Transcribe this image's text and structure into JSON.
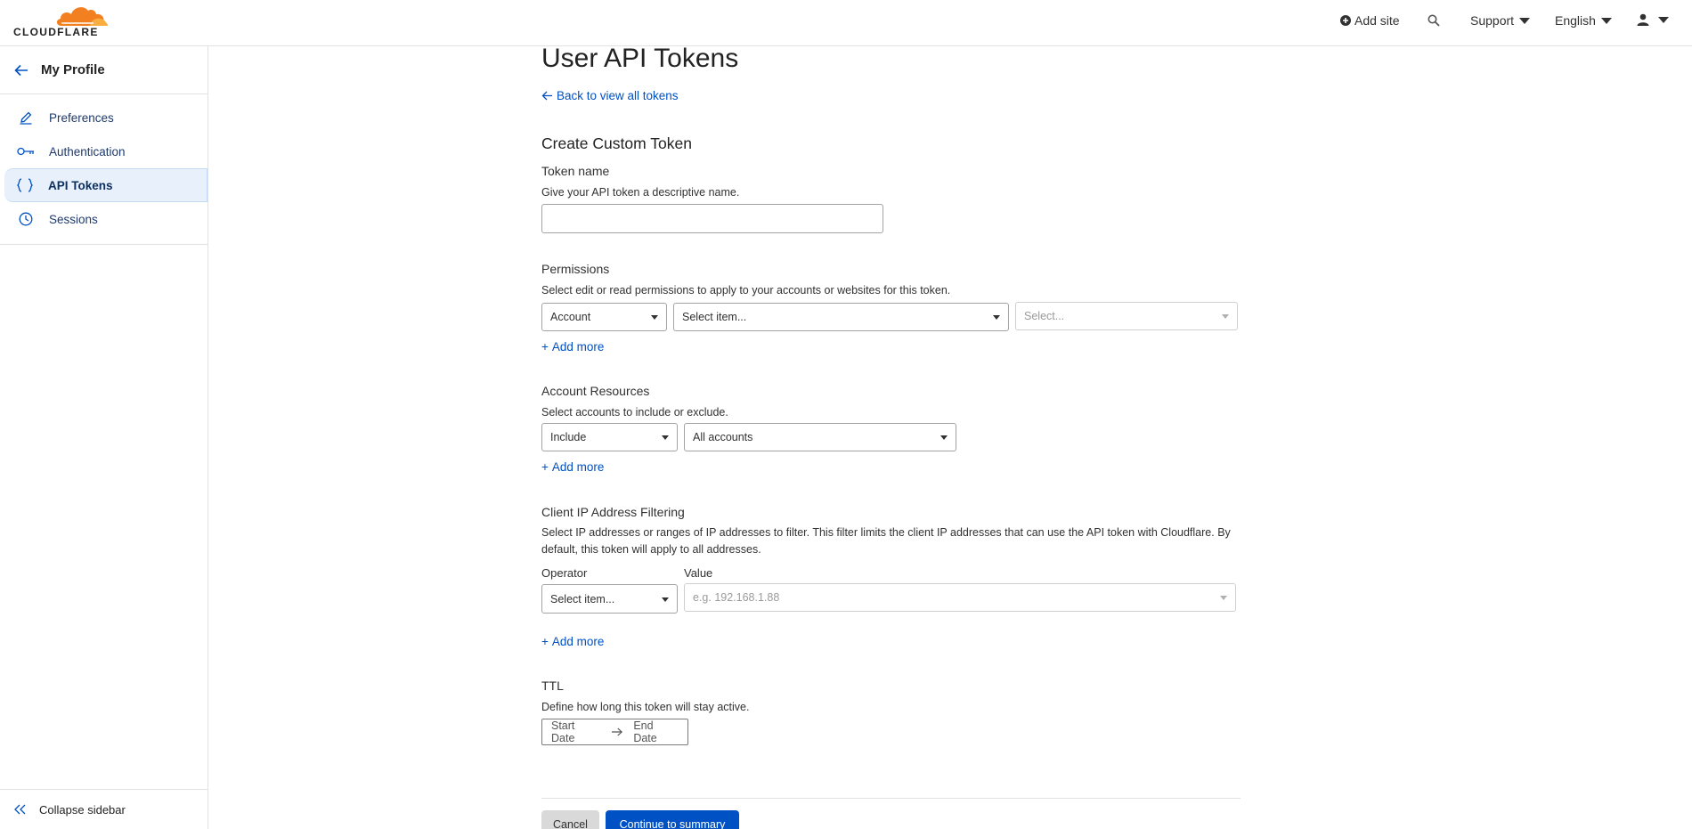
{
  "brand": {
    "name": "CLOUDFLARE",
    "accent": "#f38020",
    "link": "#0051c3"
  },
  "topnav": {
    "add_site": "Add site",
    "support": "Support",
    "language": "English"
  },
  "sidebar": {
    "title": "My Profile",
    "items": [
      {
        "label": "Preferences",
        "icon": "pencil-icon"
      },
      {
        "label": "Authentication",
        "icon": "key-icon"
      },
      {
        "label": "API Tokens",
        "icon": "braces-icon",
        "active": true
      },
      {
        "label": "Sessions",
        "icon": "clock-icon"
      }
    ],
    "collapse": "Collapse sidebar"
  },
  "main": {
    "title": "User API Tokens",
    "back_link": "Back to view all tokens",
    "section_title": "Create Custom Token",
    "token_name": {
      "label": "Token name",
      "help": "Give your API token a descriptive name.",
      "value": ""
    },
    "permissions": {
      "label": "Permissions",
      "help": "Select edit or read permissions to apply to your accounts or websites for this token.",
      "scope": "Account",
      "item": "Select item...",
      "level": "Select...",
      "add_more": "Add more"
    },
    "account_resources": {
      "label": "Account Resources",
      "help": "Select accounts to include or exclude.",
      "mode": "Include",
      "target": "All accounts",
      "add_more": "Add more"
    },
    "ip_filtering": {
      "label": "Client IP Address Filtering",
      "help": "Select IP addresses or ranges of IP addresses to filter. This filter limits the client IP addresses that can use the API token with Cloudflare. By default, this token will apply to all addresses.",
      "operator_label": "Operator",
      "value_label": "Value",
      "operator": "Select item...",
      "value_placeholder": "e.g. 192.168.1.88",
      "add_more": "Add more"
    },
    "ttl": {
      "label": "TTL",
      "help": "Define how long this token will stay active.",
      "start": "Start Date",
      "end": "End Date"
    },
    "actions": {
      "cancel": "Cancel",
      "continue": "Continue to summary"
    }
  }
}
